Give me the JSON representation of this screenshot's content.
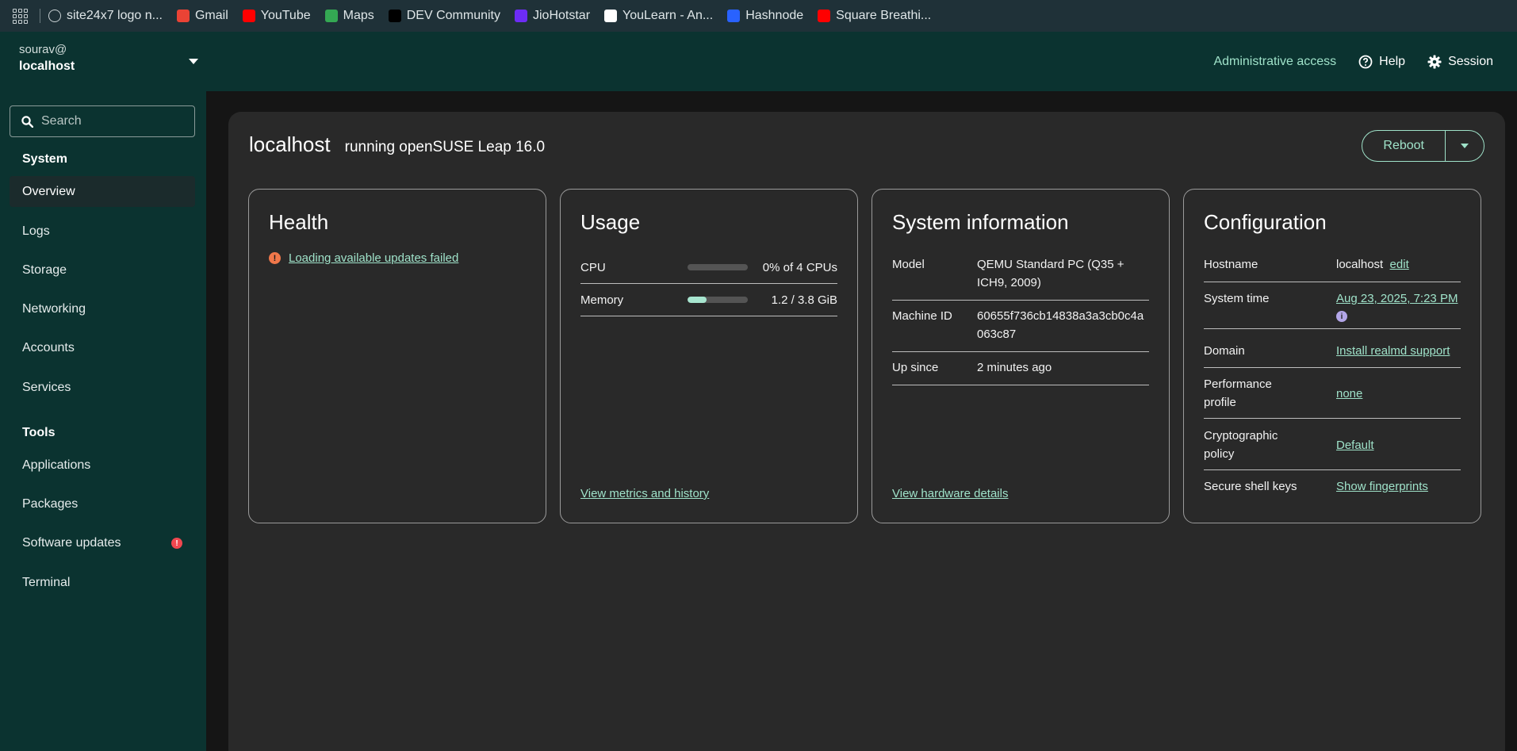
{
  "bookmarks": [
    {
      "label": "site24x7 logo n...",
      "icon": "globe-icon",
      "color": "#c9d1d4"
    },
    {
      "label": "Gmail",
      "icon": "gmail-icon",
      "color": "#ea4335"
    },
    {
      "label": "YouTube",
      "icon": "youtube-icon",
      "color": "#ff0000"
    },
    {
      "label": "Maps",
      "icon": "maps-icon",
      "color": "#34a853"
    },
    {
      "label": "DEV Community",
      "icon": "dev-icon",
      "color": "#000000"
    },
    {
      "label": "JioHotstar",
      "icon": "jiohotstar-icon",
      "color": "#6d2cf5"
    },
    {
      "label": "YouLearn - An...",
      "icon": "youlearn-icon",
      "color": "#ffffff"
    },
    {
      "label": "Hashnode",
      "icon": "hashnode-icon",
      "color": "#2962ff"
    },
    {
      "label": "Square Breathi...",
      "icon": "youtube-icon",
      "color": "#ff0000"
    }
  ],
  "masthead": {
    "user": "sourav@",
    "host": "localhost",
    "admin_access": "Administrative access",
    "help": "Help",
    "session": "Session"
  },
  "sidebar": {
    "search_placeholder": "Search",
    "system_label": "System",
    "tools_label": "Tools",
    "system_items": [
      "Overview",
      "Logs",
      "Storage",
      "Networking",
      "Accounts",
      "Services"
    ],
    "tool_items": [
      "Applications",
      "Packages",
      "Software updates",
      "Terminal"
    ],
    "badge_text": "!"
  },
  "page": {
    "hostname": "localhost",
    "os": "running openSUSE Leap 16.0",
    "reboot": "Reboot"
  },
  "health": {
    "title": "Health",
    "message": "Loading available updates failed"
  },
  "usage": {
    "title": "Usage",
    "cpu_label": "CPU",
    "cpu_value": "0% of 4 CPUs",
    "cpu_fraction": 0.0,
    "memory_label": "Memory",
    "memory_value": "1.2 / 3.8 GiB",
    "memory_fraction": 0.32,
    "footer": "View metrics and history"
  },
  "sysinfo": {
    "title": "System information",
    "model_label": "Model",
    "model_value": "QEMU Standard PC (Q35 + ICH9, 2009)",
    "machine_label": "Machine ID",
    "machine_value": "60655f736cb14838a3a3cb0c4a063c87",
    "up_label": "Up since",
    "up_value": "2 minutes ago",
    "footer": "View hardware details"
  },
  "config": {
    "title": "Configuration",
    "hostname_label": "Hostname",
    "hostname_value": "localhost",
    "hostname_edit": "edit",
    "time_label": "System time",
    "time_value": "Aug 23, 2025, 7:23 PM",
    "domain_label": "Domain",
    "domain_value": "Install realmd support",
    "perf_label": "Performance profile",
    "perf_value": "none",
    "crypto_label": "Cryptographic policy",
    "crypto_value": "Default",
    "ssh_label": "Secure shell keys",
    "ssh_value": "Show fingerprints"
  },
  "colors": {
    "accent": "#9fe2c9",
    "masthead_bg": "#0b3330",
    "error": "#f0474f"
  }
}
